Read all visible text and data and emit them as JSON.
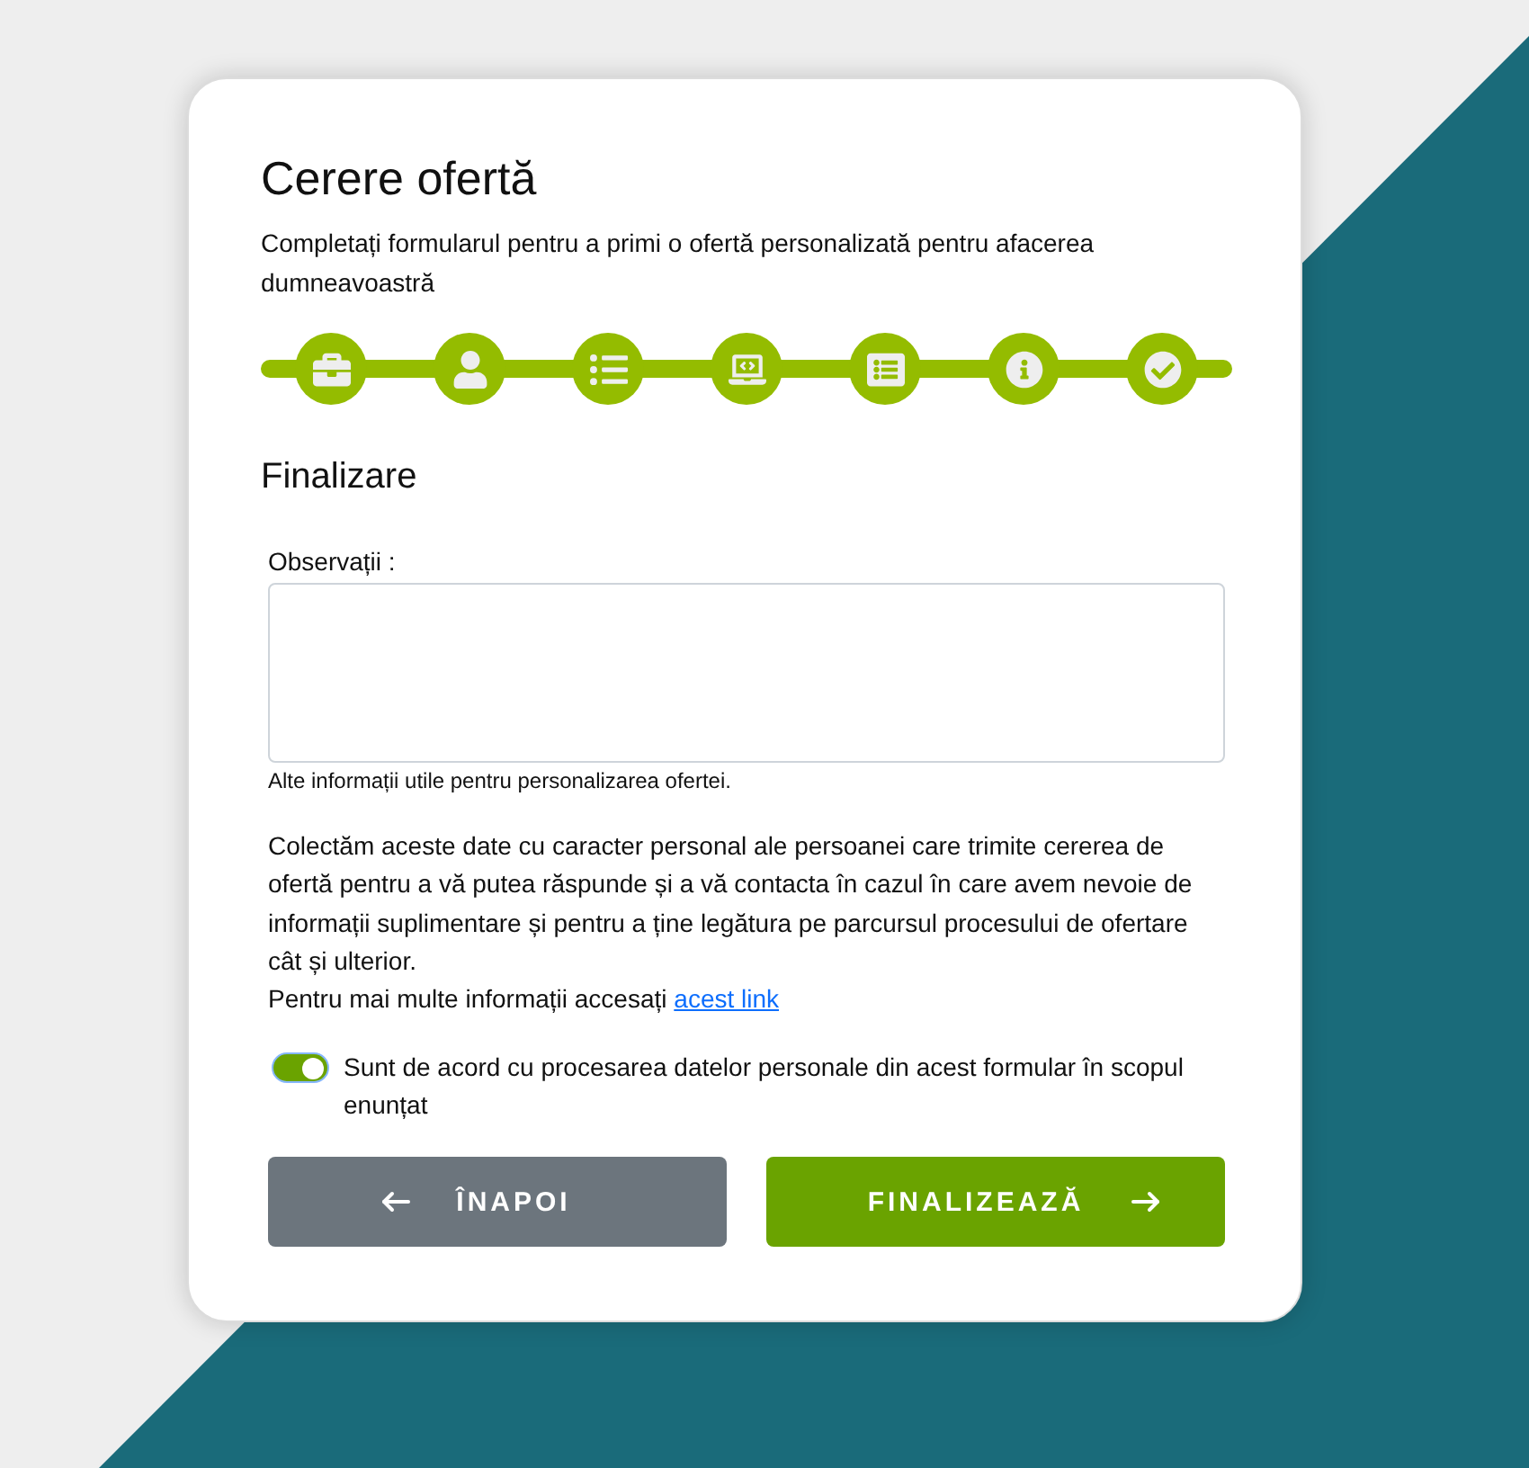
{
  "form": {
    "title": "Cerere ofertă",
    "subtitle": "Completați formularul pentru a primi o ofertă personalizată pentru afacerea dumneavoastră"
  },
  "steps": [
    {
      "kind": "briefcase"
    },
    {
      "kind": "user"
    },
    {
      "kind": "list"
    },
    {
      "kind": "laptop"
    },
    {
      "kind": "list-box"
    },
    {
      "kind": "info"
    },
    {
      "kind": "check"
    }
  ],
  "section": {
    "title": "Finalizare"
  },
  "notes_field": {
    "label": "Observații :",
    "help": "Alte informații utile pentru personalizarea ofertei."
  },
  "privacy": {
    "text": "Colectăm aceste date cu caracter personal ale persoanei care trimite cererea de ofertă pentru a vă putea răspunde și a vă contacta în cazul în care avem nevoie de informații suplimentare și pentru a ține legătura pe parcursul procesului de ofertare cât și ulterior.",
    "more_info": "Pentru mai multe informații accesați",
    "link": "acest link"
  },
  "consent": {
    "label": "Sunt de acord cu procesarea datelor personale din acest formular în scopul enunțat",
    "checked": true
  },
  "buttons": [
    {
      "kind": "back",
      "label": "ÎNAPOI"
    },
    {
      "kind": "next",
      "label": "FINALIZEAZĂ"
    }
  ]
}
